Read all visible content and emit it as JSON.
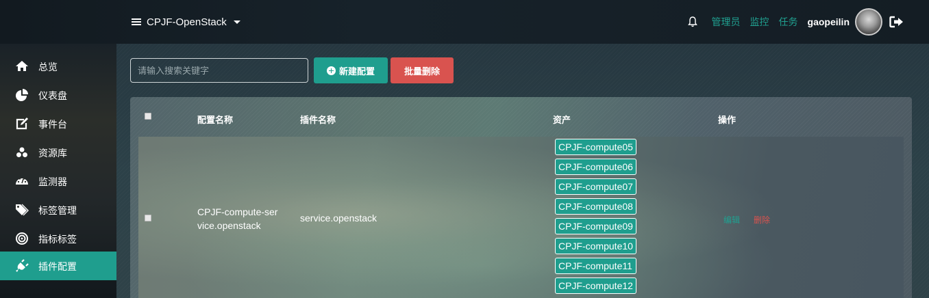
{
  "header": {
    "project_name": "CPJF-OpenStack",
    "links": [
      "管理员",
      "监控",
      "任务"
    ],
    "username": "gaopeilin"
  },
  "sidebar": {
    "items": [
      {
        "label": "总览",
        "icon": "home-icon"
      },
      {
        "label": "仪表盘",
        "icon": "pie-chart-icon"
      },
      {
        "label": "事件台",
        "icon": "edit-icon"
      },
      {
        "label": "资源库",
        "icon": "cubes-icon"
      },
      {
        "label": "监测器",
        "icon": "dashboard-icon"
      },
      {
        "label": "标签管理",
        "icon": "tags-icon"
      },
      {
        "label": "指标标签",
        "icon": "bullseye-icon"
      },
      {
        "label": "插件配置",
        "icon": "plug-icon",
        "active": true
      }
    ]
  },
  "toolbar": {
    "search_placeholder": "请输入搜索关键字",
    "new_label": "新建配置",
    "bulk_delete_label": "批量删除"
  },
  "table": {
    "headers": [
      "配置名称",
      "插件名称",
      "资产",
      "操作"
    ],
    "rows": [
      {
        "config_name": "CPJF-compute-service.openstack",
        "plugin_name": "service.openstack",
        "assets": [
          "CPJF-compute05",
          "CPJF-compute06",
          "CPJF-compute07",
          "CPJF-compute08",
          "CPJF-compute09",
          "CPJF-compute10",
          "CPJF-compute11",
          "CPJF-compute12"
        ],
        "edit_label": "编辑",
        "delete_label": "删除"
      }
    ]
  },
  "colors": {
    "accent": "#1f9e8e",
    "danger": "#d9534f"
  }
}
